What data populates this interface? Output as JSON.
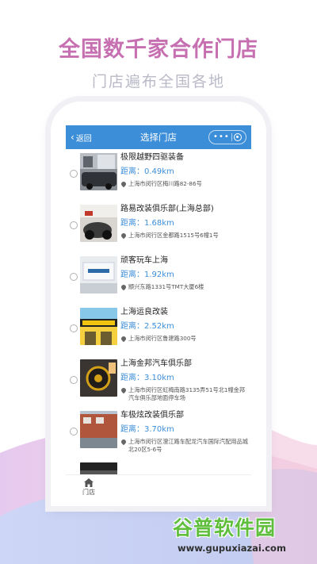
{
  "promo": {
    "headline": "全国数千家合作门店",
    "subline": "门店遍布全国各地"
  },
  "navbar": {
    "back_label": "返回",
    "title": "选择门店",
    "more_icon": "more-dots-icon",
    "close_icon": "target-icon",
    "color": "#3d8ed8"
  },
  "stores": [
    {
      "name": "极限越野四驱装备",
      "distance": "距离：0.49km",
      "address": "上海市闵行区梅川路82-86号"
    },
    {
      "name": "路易改装俱乐部(上海总部)",
      "distance": "距离：1.68km",
      "address": "上海市闵行区金都路1515号6幢1号"
    },
    {
      "name": "顽客玩车上海",
      "distance": "距离：1.92km",
      "address": "颛兴东路1331号TMT大厦6楼"
    },
    {
      "name": "上海运良改装",
      "distance": "距离：2.52km",
      "address": "上海市闵行区鲁建路300号"
    },
    {
      "name": "上海金邦汽车俱乐部",
      "distance": "距离：3.10km",
      "address": "上海市闵行区虹梅南路3135弄51号北1幢金邦汽车俱乐部地面停车场"
    },
    {
      "name": "车极炫改装俱乐部",
      "distance": "距离：3.70km",
      "address": "上海市闵行区澄江路车配龙汽车国际汽配用品城北20区5-6号"
    }
  ],
  "tabbar": {
    "home_label": "门店",
    "home_icon": "home-icon"
  },
  "watermark": {
    "title": "谷普软件园",
    "url": "www.gupuxiazai.com"
  },
  "colors": {
    "headline": "#c66fb1",
    "accent": "#3d8ed8",
    "watermark": "#5fbf3c"
  }
}
